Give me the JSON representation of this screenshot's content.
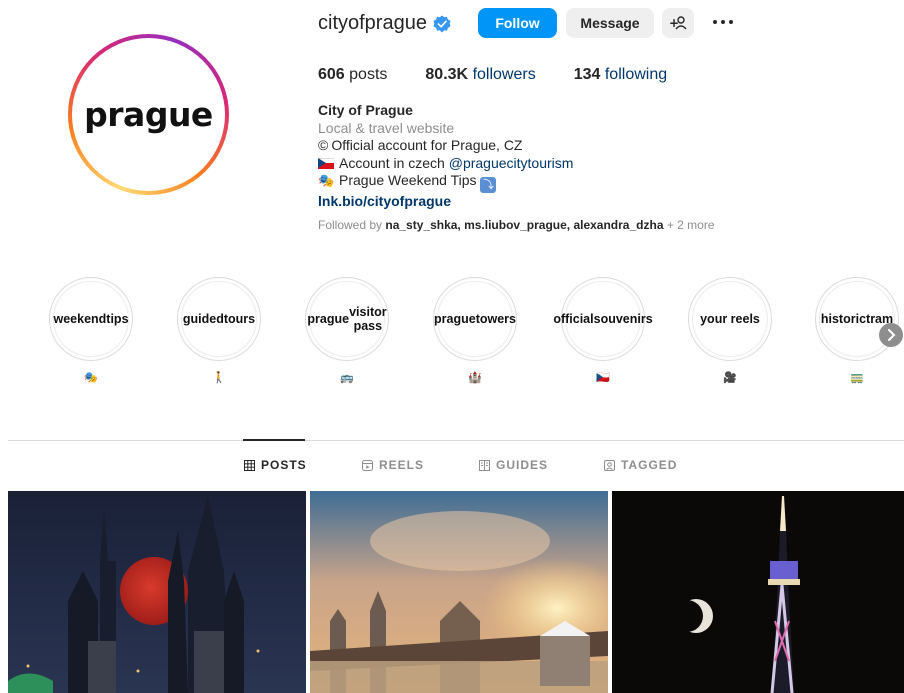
{
  "profile": {
    "avatar_text": "prague",
    "username": "cityofprague",
    "follow_label": "Follow",
    "message_label": "Message",
    "add_user_icon": "+♙",
    "more_icon": "more-horizontal-icon"
  },
  "stats": {
    "posts_count": "606",
    "posts_label": "posts",
    "followers_count": "80.3K",
    "followers_label": "followers",
    "following_count": "134",
    "following_label": "following"
  },
  "bio": {
    "name": "City of Prague",
    "category": "Local & travel website",
    "line1_symbol": "©",
    "line1": "Official account for Prague, CZ",
    "line2_text": "Account in czech ",
    "line2_mention": "@praguecitytourism",
    "line3_text": "Prague Weekend Tips ",
    "link": "lnk.bio/cityofprague"
  },
  "followed_by": {
    "prefix": "Followed by ",
    "users": "na_sty_shka, ms.liubov_prague, alexandra_dzha",
    "suffix": " + 2 more"
  },
  "highlights": [
    {
      "line1": "weekend",
      "line2": "tips",
      "emoji": "🎭"
    },
    {
      "line1": "guided",
      "line2": "tours",
      "emoji": "🚶"
    },
    {
      "line1": "prague",
      "line2": "visitor pass",
      "emoji": "🚌"
    },
    {
      "line1": "prague",
      "line2": "towers",
      "emoji": "🏰"
    },
    {
      "line1": "official",
      "line2": "souvenirs",
      "emoji": "🇨🇿"
    },
    {
      "line1": "your reels",
      "line2": "",
      "emoji": "🎥"
    },
    {
      "line1": "historic",
      "line2": "tram",
      "emoji": "🚃"
    }
  ],
  "tabs": [
    {
      "label": "POSTS",
      "icon": "grid-icon",
      "active": true
    },
    {
      "label": "REELS",
      "icon": "reels-icon",
      "active": false
    },
    {
      "label": "GUIDES",
      "icon": "guides-icon",
      "active": false
    },
    {
      "label": "TAGGED",
      "icon": "tagged-icon",
      "active": false
    }
  ],
  "colors": {
    "follow_button": "#0095f6",
    "link": "#00376b",
    "muted": "#8e8e8e",
    "moon_red": "#c0231e"
  }
}
